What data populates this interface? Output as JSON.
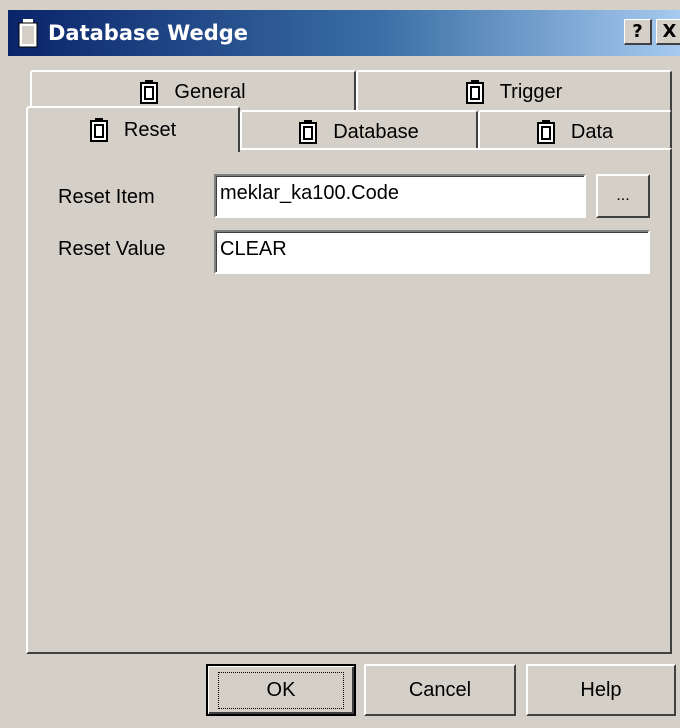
{
  "window": {
    "title": "Database Wedge",
    "help_button": "?",
    "close_button": "X",
    "icon": "battery-icon"
  },
  "tabs": {
    "general": "General",
    "trigger": "Trigger",
    "reset": "Reset",
    "database": "Database",
    "data": "Data",
    "active": "Reset"
  },
  "form": {
    "reset_item_label": "Reset Item",
    "reset_item_value": "meklar_ka100.Code",
    "browse_button": "...",
    "reset_value_label": "Reset Value",
    "reset_value_value": "CLEAR"
  },
  "buttons": {
    "ok": "OK",
    "cancel": "Cancel",
    "help": "Help"
  }
}
